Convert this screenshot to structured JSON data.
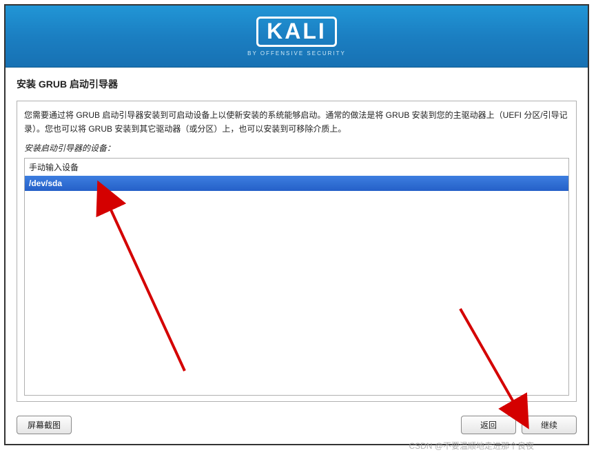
{
  "logo": {
    "text": "KALI",
    "subtitle": "BY OFFENSIVE SECURITY"
  },
  "page": {
    "title": "安装 GRUB 启动引导器",
    "description": "您需要通过将 GRUB 启动引导器安装到可启动设备上以使新安装的系统能够启动。通常的做法是将 GRUB 安装到您的主驱动器上（UEFI 分区/引导记录）。您也可以将 GRUB 安装到其它驱动器（或分区）上，也可以安装到可移除介质上。",
    "device_label": "安装启动引导器的设备："
  },
  "devices": {
    "options": [
      {
        "label": "手动输入设备",
        "selected": false
      },
      {
        "label": "/dev/sda",
        "selected": true
      }
    ]
  },
  "buttons": {
    "screenshot": "屏幕截图",
    "back": "返回",
    "continue": "继续"
  },
  "watermark": "CSDN @不要温顺地走进那个良夜"
}
